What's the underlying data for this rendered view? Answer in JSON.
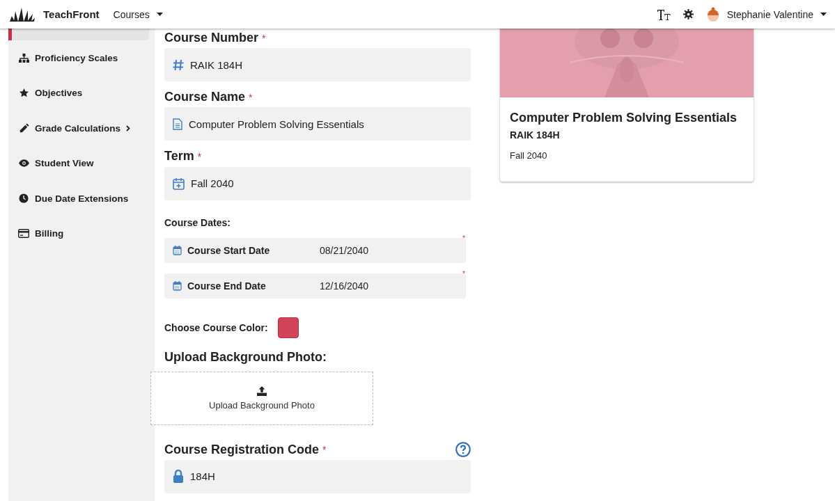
{
  "header": {
    "brand": "TeachFront",
    "nav_menu": "Courses",
    "user_name": "Stephanie Valentine"
  },
  "sidebar": {
    "items": [
      {
        "kind": "stub",
        "selected": true
      },
      {
        "kind": "link",
        "label": "Proficiency Scales",
        "selected": false
      },
      {
        "kind": "link",
        "label": "Objectives",
        "selected": false
      },
      {
        "kind": "submenu",
        "label": "Grade Calculations",
        "selected": false
      },
      {
        "kind": "link",
        "label": "Student View",
        "selected": false
      },
      {
        "kind": "link",
        "label": "Due Date Extensions",
        "selected": false
      },
      {
        "kind": "link",
        "label": "Billing",
        "selected": false
      }
    ]
  },
  "form": {
    "course_number": {
      "label": "Course Number",
      "required_mark": "*",
      "value": "RAIK 184H"
    },
    "course_name": {
      "label": "Course Name",
      "required_mark": "*",
      "value": "Computer Problem Solving Essentials"
    },
    "term": {
      "label": "Term",
      "required_mark": "*",
      "value": "Fall 2040"
    },
    "course_dates": {
      "label": "Course Dates:",
      "dates": [
        {
          "label": "Course Start Date",
          "value": "08/21/2040",
          "required_mark": "*"
        },
        {
          "label": "Course End Date",
          "value": "12/16/2040",
          "required_mark": "*"
        }
      ]
    },
    "course_color": {
      "label": "Choose Course Color:",
      "color": "#d0435b"
    },
    "upload": {
      "heading": "Upload Background Photo:",
      "button": "Upload Background Photo"
    },
    "registration_code": {
      "label": "Course Registration Code",
      "required_mark": "*",
      "value": "184H"
    }
  },
  "preview_card": {
    "title": "Computer Problem Solving Essentials",
    "code": "RAIK 184H",
    "term": "Fall 2040"
  }
}
